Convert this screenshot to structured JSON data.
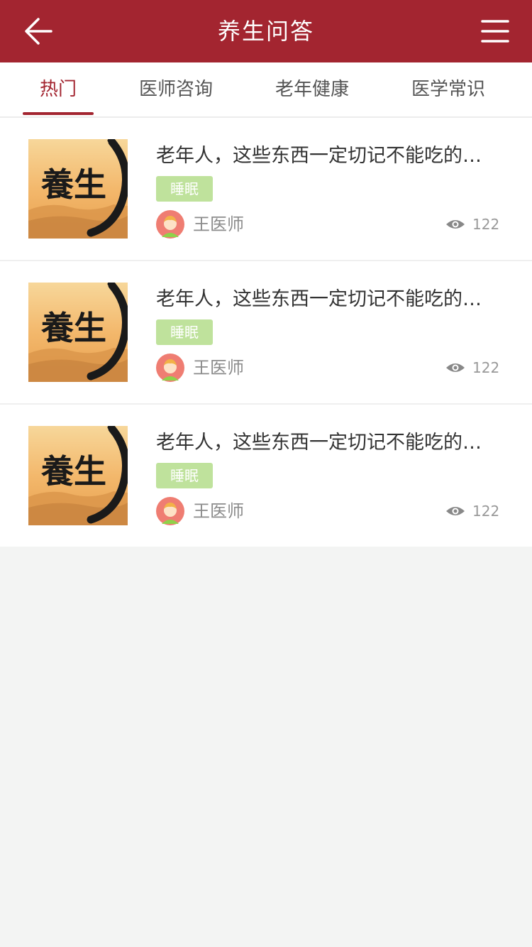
{
  "header": {
    "title": "养生问答",
    "back_icon": "arrow-left-icon",
    "menu_icon": "menu-icon",
    "background": "#a32530"
  },
  "tabs": [
    {
      "label": "热门",
      "active": true
    },
    {
      "label": "医师咨询",
      "active": false
    },
    {
      "label": "老年健康",
      "active": false
    },
    {
      "label": "医学常识",
      "active": false
    }
  ],
  "thumbnail_text": "養生",
  "items": [
    {
      "title": "老年人，这些东西一定切记不能吃的，千万注意",
      "tag": "睡眠",
      "author": "王医师",
      "views": "122"
    },
    {
      "title": "老年人，这些东西一定切记不能吃的，千万注意",
      "tag": "睡眠",
      "author": "王医师",
      "views": "122"
    },
    {
      "title": "老年人，这些东西一定切记不能吃的，千万注意",
      "tag": "睡眠",
      "author": "王医师",
      "views": "122"
    }
  ],
  "colors": {
    "accent": "#a32530",
    "tag_bg": "#bfe29c",
    "page_bg": "#f3f4f3"
  }
}
